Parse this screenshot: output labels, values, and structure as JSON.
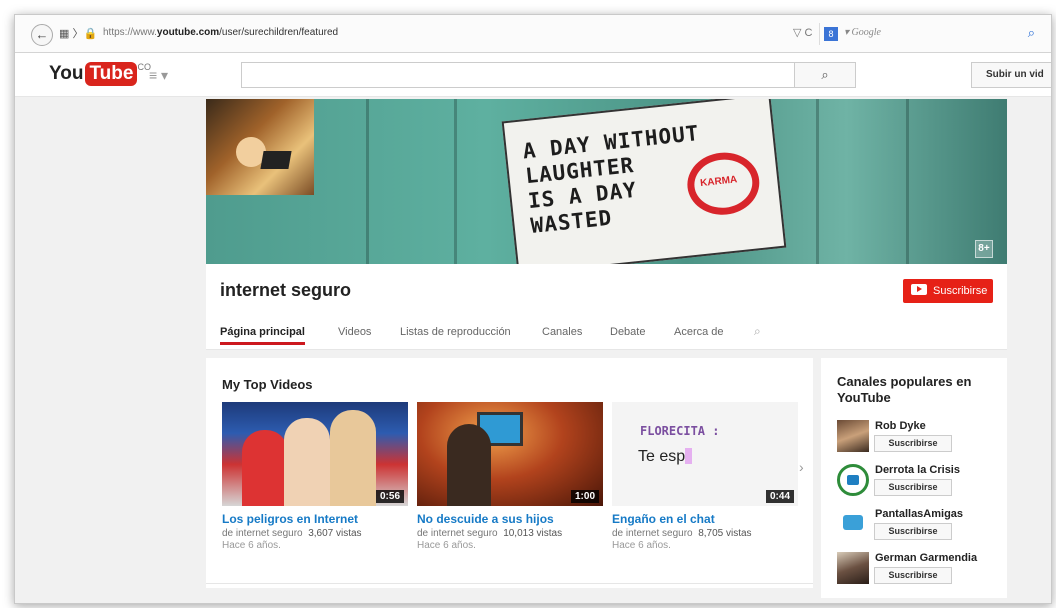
{
  "browser": {
    "back_glyph": "←",
    "nav_glyphs": "▦ 〉🔒",
    "url_prefix": "https://www.",
    "url_domain": "youtube.com",
    "url_path": "/user/surechildren/featured",
    "tools_glyphs": "▽ C",
    "search_engine_badge": "8",
    "search_engine_arrow": "▾",
    "search_placeholder": "Google",
    "search_icon": "magnifier-icon"
  },
  "youtube_header": {
    "logo_you": "You",
    "logo_tube": "Tube",
    "logo_country": "CO",
    "menu_glyph": "≡ ▾",
    "search_value": "",
    "search_button_glyph": "🔍",
    "upload_label": "Subir un vid"
  },
  "banner": {
    "sign_line1": "A DAY WITHOUT",
    "sign_line2": "LAUGHTER",
    "sign_line3": "IS A DAY",
    "sign_line4": "WASTED",
    "karma_label": "KARMA",
    "gplus_label": "8+"
  },
  "channel": {
    "title": "internet seguro",
    "subscribe_label": "Suscribirse",
    "tabs": [
      {
        "label": "Página principal",
        "active": true
      },
      {
        "label": "Videos"
      },
      {
        "label": "Listas de reproducción"
      },
      {
        "label": "Canales"
      },
      {
        "label": "Debate"
      },
      {
        "label": "Acerca de"
      }
    ],
    "tab_search_glyph": "🔍"
  },
  "main": {
    "section_title": "My Top Videos",
    "next_glyph": "›",
    "videos": [
      {
        "title": "Los peligros en Internet",
        "channel": "de internet seguro",
        "views": "3,607 vistas",
        "age": "Hace 6 años.",
        "duration": "0:56"
      },
      {
        "title": "No descuide a sus hijos",
        "channel": "de internet seguro",
        "views": "10,013 vistas",
        "age": "Hace 6 años.",
        "duration": "1:00"
      },
      {
        "title": "Engaño en el chat",
        "channel": "de internet seguro",
        "views": "8,705 vistas",
        "age": "Hace 6 años.",
        "duration": "0:44",
        "thumb_caption": "FLORECITA :",
        "thumb_text": "Te esp"
      }
    ]
  },
  "sidebar": {
    "title": "Canales populares en YouTube",
    "channels": [
      {
        "name": "Rob Dyke",
        "button": "Suscribirse"
      },
      {
        "name": "Derrota la Crisis",
        "button": "Suscribirse"
      },
      {
        "name": "PantallasAmigas",
        "button": "Suscribirse"
      },
      {
        "name": "German Garmendia",
        "button": "Suscribirse"
      }
    ]
  },
  "colors": {
    "youtube_red": "#e62117",
    "link_blue": "#167ac6",
    "active_tab_underline": "#cc181e"
  }
}
